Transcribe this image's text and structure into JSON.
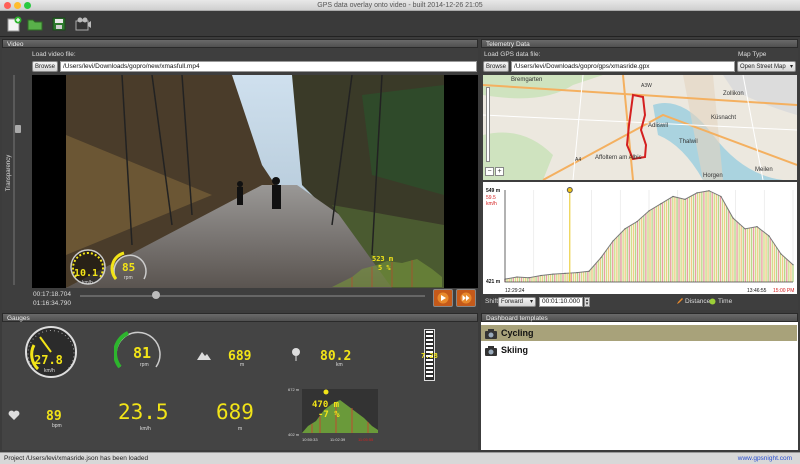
{
  "window": {
    "title": "GPS data overlay onto video - built 2014-12-26 21:05"
  },
  "toolbar": {
    "icons": [
      "new-icon",
      "open-folder-icon",
      "save-icon",
      "export-video-icon"
    ]
  },
  "video_panel": {
    "title": "Video",
    "load_label": "Load video file:",
    "browse_label": "Browse",
    "file_path": "/Users/levi/Downloads/gopro/new/xmasfull.mp4",
    "transparency_label": "Transparency",
    "time_current": "00:17:18.704",
    "time_total": "01:16:34.790",
    "overlay": {
      "speed": "10.1",
      "speed_unit": "km/h",
      "cadence": "85",
      "cadence_unit": "rpm",
      "altitude": "523 m",
      "grade": "5 %"
    }
  },
  "telemetry_panel": {
    "title": "Telemetry Data",
    "load_label": "Load GPS data file:",
    "browse_label": "Browse",
    "file_path": "/Users/levi/Downloads/gopro/gps/xmasride.gpx",
    "map_type_label": "Map Type",
    "map_type_value": "Open Street Map",
    "map_places": [
      "Bremgarten",
      "A3W",
      "Zollikon",
      "Adliswil",
      "Küsnacht",
      "A4",
      "Affoltern am Albis",
      "Thalwil",
      "Horgen",
      "Meilen"
    ],
    "chart_top_label": "549 m",
    "chart_speed_label": "59.5 km/h",
    "chart_bottom_label": "421 m",
    "chart_start_time": "12:29:24",
    "chart_end_time": "13:46:55",
    "chart_end_time2": "15:00 PM",
    "shift_label": "Shift",
    "shift_direction": "Forward",
    "shift_time": "00:01:10.000",
    "distance_label": "Distance",
    "time_label": "Time"
  },
  "chart_data": {
    "type": "area",
    "title": "",
    "xlabel": "",
    "ylabel": "",
    "x": [
      "12:29:24",
      "",
      "",
      "",
      "",
      "",
      "",
      "",
      "",
      "",
      "",
      "",
      "",
      "",
      "",
      "",
      "",
      "",
      "",
      "",
      "",
      "",
      "",
      "",
      "13:46:55"
    ],
    "ylim": [
      421,
      549
    ],
    "values": [
      425,
      428,
      427,
      430,
      432,
      433,
      434,
      436,
      455,
      478,
      495,
      505,
      520,
      530,
      540,
      536,
      545,
      548,
      540,
      510,
      495,
      498,
      485,
      460,
      445
    ]
  },
  "gauges_panel": {
    "title": "Gauges",
    "speed_value": "27.8",
    "speed_unit": "km/h",
    "cadence_value": "81",
    "cadence_unit": "rpm",
    "altitude_value": "689",
    "altitude_unit": "m",
    "temp_value": "80.2",
    "temp_unit": "km",
    "vertical_value": "7.28",
    "heart_value": "89",
    "heart_unit": "bpm",
    "speed_big": "23.5",
    "speed_big_unit": "km/h",
    "altitude_big": "689",
    "altitude_big_unit": "m",
    "mini_alt": "470 m",
    "mini_grade": "-7 %",
    "mini_top": "672 m",
    "mini_bottom": "402 m",
    "mini_t1": "10:50:33",
    "mini_t2": "11:02:39",
    "mini_t3": "11:05:55"
  },
  "dashboard_panel": {
    "title": "Dashboard templates",
    "templates": [
      {
        "name": "Cycling",
        "selected": true
      },
      {
        "name": "Skiing",
        "selected": false
      }
    ]
  },
  "status": {
    "message": "Project /Users/levi/xmasride.json has been loaded",
    "link": "www.gpsnight.com"
  },
  "colors": {
    "accent_yellow": "#f2e418",
    "route_red": "#d42020",
    "selected_row": "#a8a27a"
  }
}
